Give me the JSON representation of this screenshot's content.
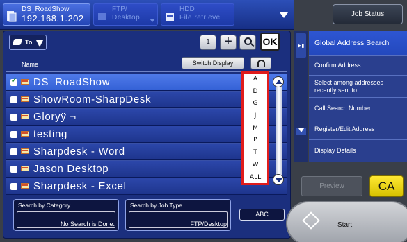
{
  "tabs": [
    {
      "line1": "DS_RoadShow",
      "line2": "192.168.1.202"
    },
    {
      "line1": "FTP/",
      "line2": "Desktop"
    },
    {
      "line1": "HDD",
      "line2": "File retrieve"
    }
  ],
  "toolbar": {
    "sort_label": "To",
    "count": "1",
    "add": "+",
    "ok": "OK"
  },
  "list_header": {
    "name": "Name",
    "switch_display": "Switch Display"
  },
  "addresses": [
    "DS_RoadShow",
    "ShowRoom-SharpDesk",
    "Gloryÿ ¬",
    "testing",
    "Sharpdesk - Word",
    "Jason Desktop",
    "Sharpdesk - Excel"
  ],
  "index_letters": [
    "A",
    "D",
    "G",
    "J",
    "M",
    "P",
    "T",
    "W",
    "ALL"
  ],
  "filters": {
    "category": {
      "label": "Search by Category",
      "value": "No Search is Done."
    },
    "job_type": {
      "label": "Search by Job Type",
      "value": "FTP/Desktop"
    },
    "abc": "ABC"
  },
  "right": {
    "job_status": "Job Status",
    "actions": [
      "Global Address Search",
      "Confirm Address",
      "Select among addresses recently sent to",
      "Call Search Number",
      "Register/Edit Address",
      "Display Details"
    ],
    "preview": "Preview",
    "ca": "CA",
    "start": "Start"
  },
  "colors": {
    "highlight_border": "#e01c1c",
    "ca_yellow": "#ffe833",
    "selected_row": "#3e6ad9"
  }
}
